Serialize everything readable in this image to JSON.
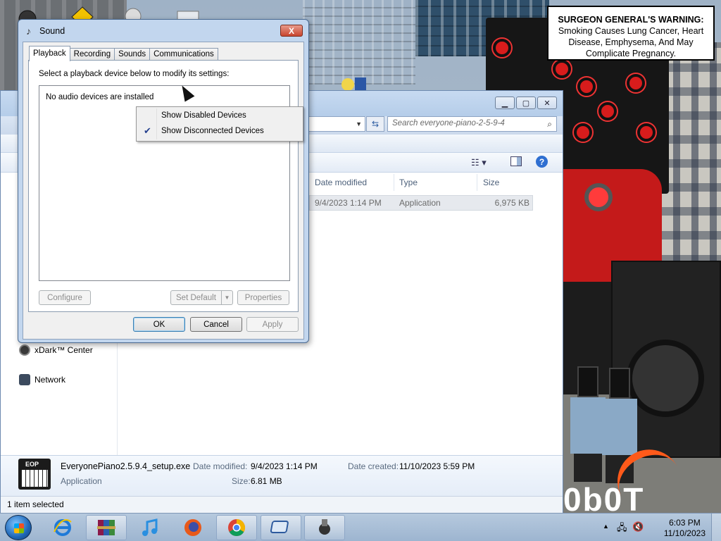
{
  "desktop": {
    "warning_title": "SURGEON GENERAL'S WARNING:",
    "warning_body": "Smoking Causes Lung Cancer, Heart Disease, Emphysema, And May Complicate Pregnancy.",
    "logo_text": "0b0T"
  },
  "explorer": {
    "search_placeholder": "Search everyone-piano-2-5-9-4",
    "columns": [
      "Date modified",
      "Type",
      "Size"
    ],
    "file_row": {
      "date": "9/4/2023 1:14 PM",
      "type": "Application",
      "size": "6,975 KB"
    },
    "nav_items": [
      "xDark™ Center",
      "Network"
    ],
    "details": {
      "filename": "EveryonePiano2.5.9.4_setup.exe",
      "filetype": "Application",
      "modified_label": "Date modified:",
      "modified_value": "9/4/2023 1:14 PM",
      "size_label": "Size:",
      "size_value": "6.81 MB",
      "created_label": "Date created:",
      "created_value": "11/10/2023 5:59 PM",
      "icon_text": "EOP"
    },
    "status": "1 item selected",
    "help_glyph": "?"
  },
  "sound": {
    "title": "Sound",
    "close_glyph": "X",
    "tabs": [
      "Playback",
      "Recording",
      "Sounds",
      "Communications"
    ],
    "instruction": "Select a playback device below to modify its settings:",
    "empty_message": "No audio devices are installed",
    "buttons": {
      "configure": "Configure",
      "set_default": "Set Default",
      "properties": "Properties",
      "ok": "OK",
      "cancel": "Cancel",
      "apply": "Apply"
    },
    "context_menu": [
      {
        "label": "Show Disabled Devices",
        "checked": false
      },
      {
        "label": "Show Disconnected Devices",
        "checked": true
      }
    ]
  },
  "taskbar": {
    "time": "6:03 PM",
    "date": "11/10/2023",
    "apps": [
      "internet-explorer",
      "winrar",
      "itunes",
      "firefox",
      "chrome",
      "virtualbox",
      "audio-tool"
    ]
  },
  "colors": {
    "accent": "#2f6fd1",
    "checkmark": "#24408e",
    "close_red": "#c8452f"
  }
}
